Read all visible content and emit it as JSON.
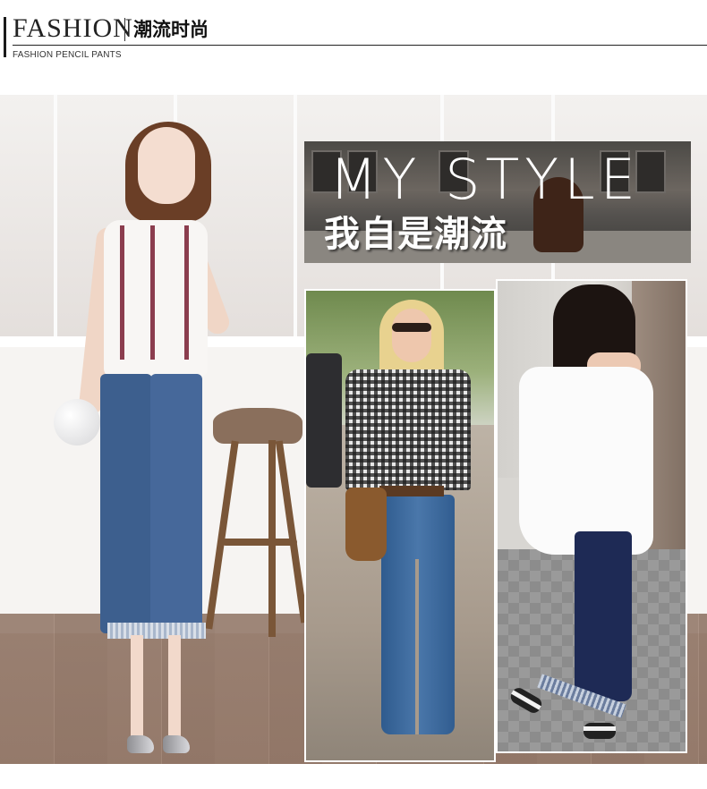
{
  "header": {
    "title_en": "FASHION",
    "title_cn": "潮流时尚",
    "subtitle": "FASHION PENCIL PANTS"
  },
  "banner": {
    "headline_en": "MY STYLE",
    "headline_cn": "我自是潮流"
  },
  "colors": {
    "denim_light": "#46689a",
    "denim_dark": "#1e2a55",
    "hair_brown": "#6a3e26",
    "accent_dark": "#222222"
  }
}
